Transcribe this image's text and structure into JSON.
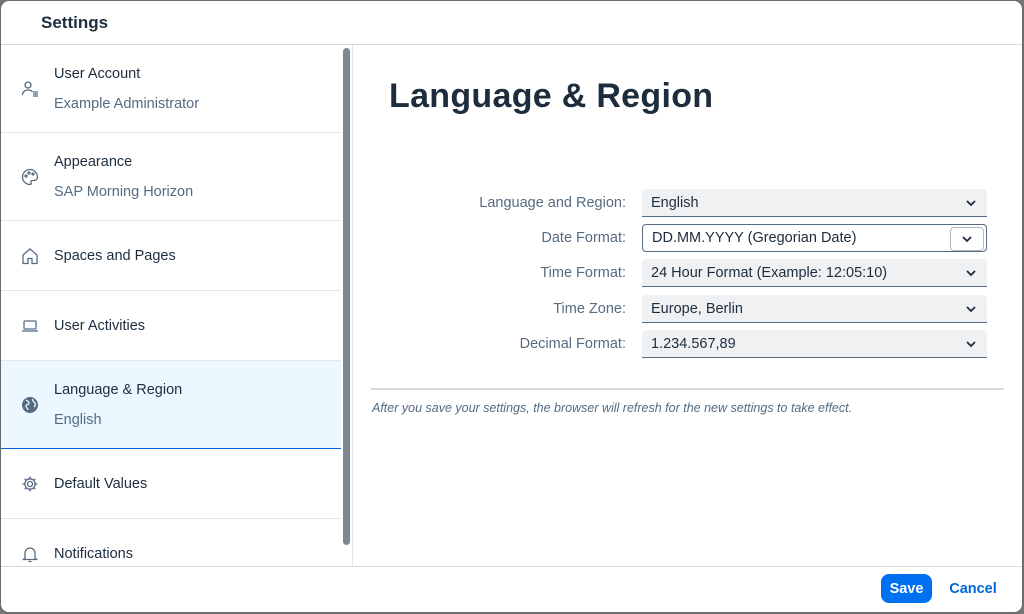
{
  "dialog": {
    "title": "Settings"
  },
  "sidebar": {
    "items": [
      {
        "title": "User Account",
        "subtitle": "Example Administrator",
        "icon": "user-account-icon"
      },
      {
        "title": "Appearance",
        "subtitle": "SAP Morning Horizon",
        "icon": "palette-icon"
      },
      {
        "title": "Spaces and Pages",
        "icon": "home-icon"
      },
      {
        "title": "User Activities",
        "icon": "laptop-icon"
      },
      {
        "title": "Language & Region",
        "subtitle": "English",
        "icon": "globe-icon",
        "selected": true
      },
      {
        "title": "Default Values",
        "icon": "gear-icon"
      },
      {
        "title": "Notifications",
        "icon": "bell-icon"
      }
    ]
  },
  "content": {
    "title": "Language & Region",
    "fields": [
      {
        "label": "Language and Region:",
        "value": "English"
      },
      {
        "label": "Date Format:",
        "value": "DD.MM.YYYY (Gregorian Date)"
      },
      {
        "label": "Time Format:",
        "value": "24 Hour Format (Example: 12:05:10)"
      },
      {
        "label": "Time Zone:",
        "value": "Europe, Berlin"
      },
      {
        "label": "Decimal Format:",
        "value": "1.234.567,89"
      }
    ],
    "note": "After you save your settings, the browser will refresh for the new settings to take effect."
  },
  "footer": {
    "save_label": "Save",
    "cancel_label": "Cancel"
  },
  "colors": {
    "accent": "#0070f2",
    "selected_bg": "#ebf8ff",
    "text": "#1d2d3e",
    "muted": "#556b82"
  }
}
